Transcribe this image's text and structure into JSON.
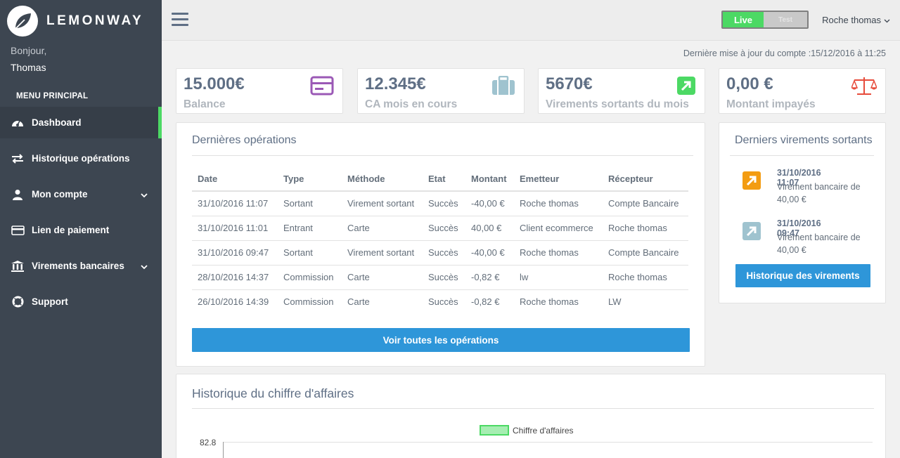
{
  "brand": {
    "name": "LEMONWAY"
  },
  "greeting": {
    "hello": "Bonjour,",
    "name": "Thomas"
  },
  "menu": {
    "title": "MENU PRINCIPAL",
    "items": [
      {
        "label": "Dashboard",
        "icon": "dashboard-icon"
      },
      {
        "label": "Historique opérations",
        "icon": "arrows-icon"
      },
      {
        "label": "Mon compte",
        "icon": "user-icon"
      },
      {
        "label": "Lien de paiement",
        "icon": "credit-card-icon"
      },
      {
        "label": "Virements bancaires",
        "icon": "bank-icon"
      },
      {
        "label": "Support",
        "icon": "lifebuoy-icon"
      }
    ]
  },
  "topbar": {
    "live": "Live",
    "test": "Test",
    "user": "Roche thomas"
  },
  "update": "Dernière mise à jour du compte :15/12/2016 à 11:25",
  "stats": [
    {
      "value": "15.000€",
      "label": "Balance",
      "icon": "credit-card-icon",
      "color": "#9b59b6"
    },
    {
      "value": "12.345€",
      "label": "CA mois en cours",
      "icon": "briefcase-icon",
      "color": "#9fc3cf"
    },
    {
      "value": "5670€",
      "label": "Virements sortants du mois",
      "icon": "arrow-up-right-icon",
      "color": "#4cd964"
    },
    {
      "value": "0,00 €",
      "label": "Montant impayés",
      "icon": "balance-scale-icon",
      "color": "#e74c3c"
    }
  ],
  "operations": {
    "title": "Dernières opérations",
    "headers": [
      "Date",
      "Type",
      "Méthode",
      "Etat",
      "Montant",
      "Emetteur",
      "Récepteur"
    ],
    "rows": [
      [
        "31/10/2016 11:07",
        "Sortant",
        "Virement sortant",
        "Succès",
        "-40,00 €",
        "Roche thomas",
        "Compte Bancaire"
      ],
      [
        "31/10/2016 11:01",
        "Entrant",
        "Carte",
        "Succès",
        "40,00 €",
        "Client ecommerce",
        "Roche thomas"
      ],
      [
        "31/10/2016 09:47",
        "Sortant",
        "Virement sortant",
        "Succès",
        "-40,00 €",
        "Roche thomas",
        "Compte Bancaire"
      ],
      [
        "28/10/2016 14:37",
        "Commission",
        "Carte",
        "Succès",
        "-0,82 €",
        "lw",
        "Roche thomas"
      ],
      [
        "26/10/2016 14:39",
        "Commission",
        "Carte",
        "Succès",
        "-0,82 €",
        "Roche thomas",
        "LW"
      ]
    ],
    "button": "Voir toutes les opérations"
  },
  "virements": {
    "title": "Derniers virements sortants",
    "items": [
      {
        "date": "31/10/2016 11:07",
        "text": "Virement bancaire de 40,00 €",
        "color": "#f39c12"
      },
      {
        "date": "31/10/2016 09:47",
        "text": "Virement bancaire de 40,00 €",
        "color": "#9fc3cf"
      }
    ],
    "button": "Historique des virements"
  },
  "ca": {
    "title": "Historique du chiffre d'affaires",
    "legend": "Chiffre d'affaires",
    "ytick": "82.8"
  }
}
